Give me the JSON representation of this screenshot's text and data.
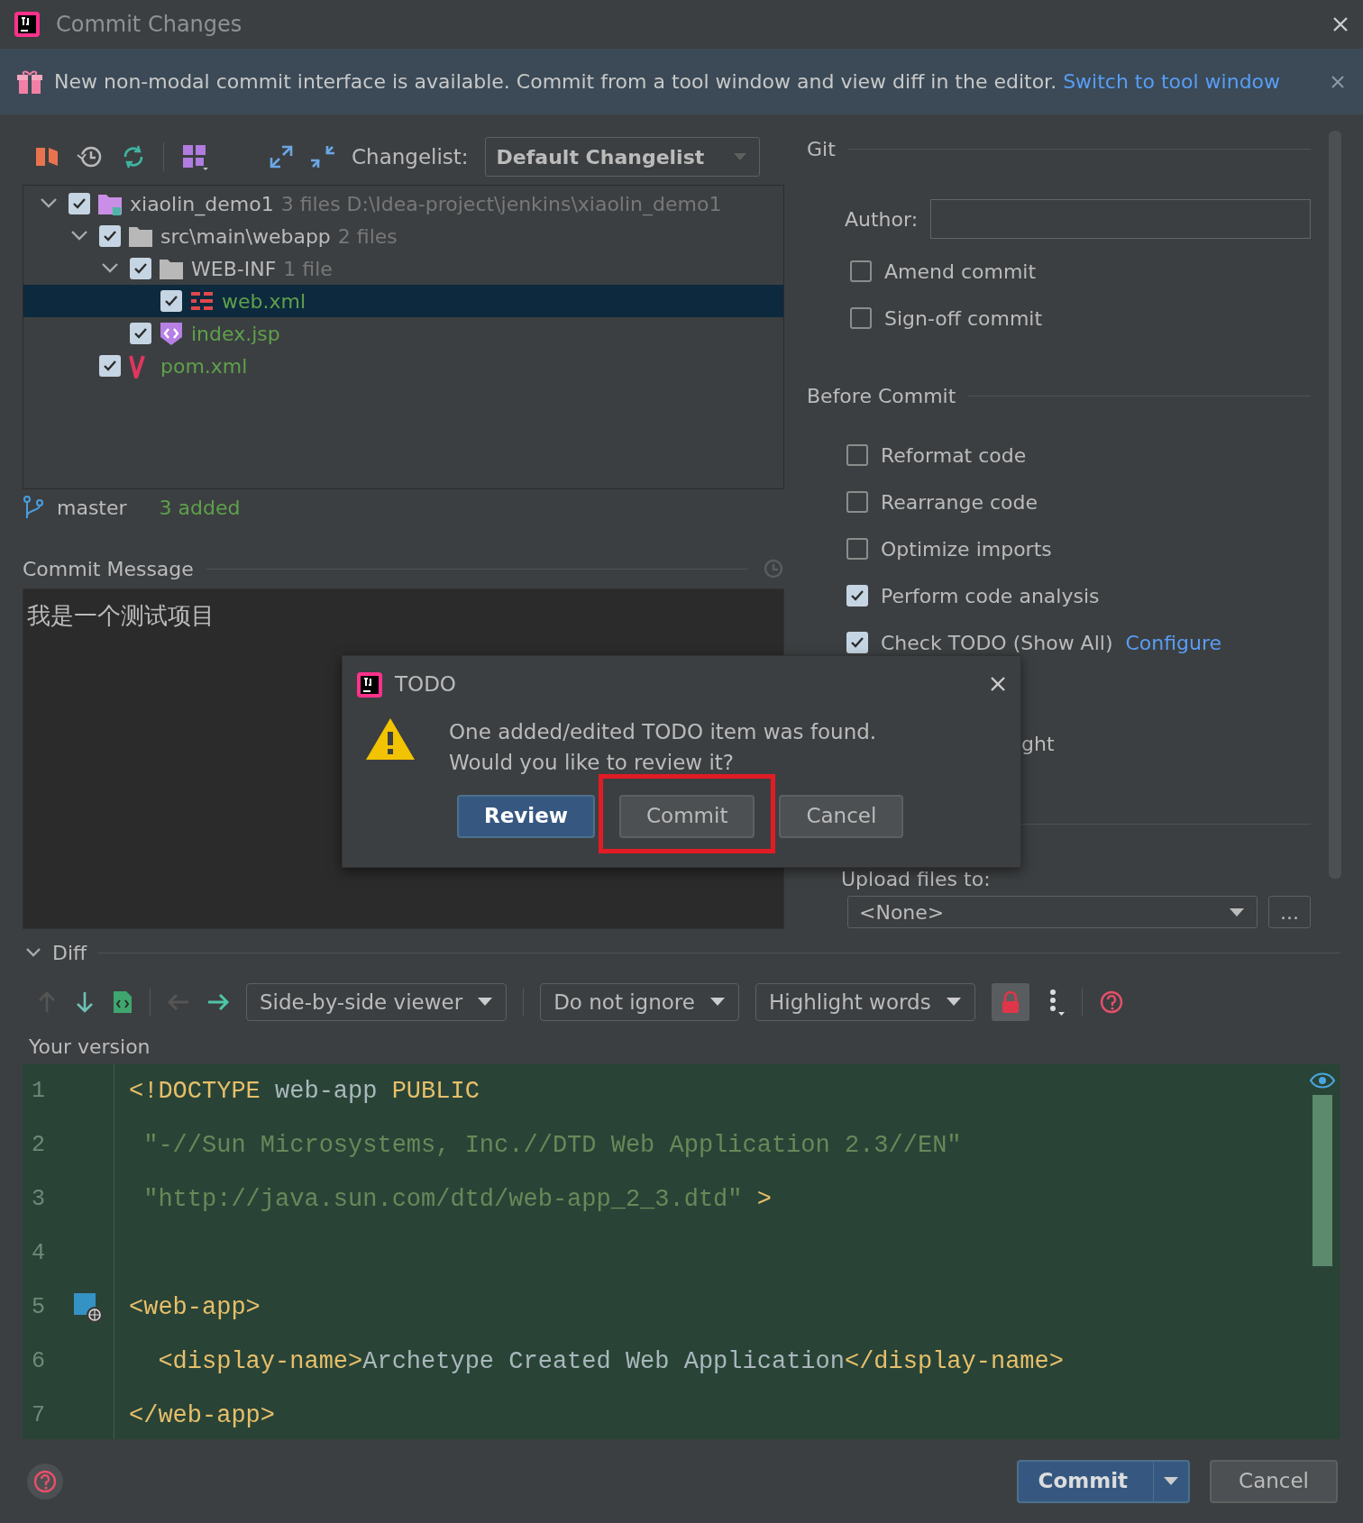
{
  "window": {
    "title": "Commit Changes"
  },
  "banner": {
    "text": "New non-modal commit interface is available. Commit from a tool window and view diff in the editor.",
    "link": "Switch to tool window"
  },
  "changes": {
    "changelist_label": "Changelist:",
    "changelist": "Default Changelist",
    "tree": [
      {
        "name": "xiaolin_demo1",
        "detail": "3 files  D:\\Idea-project\\jenkins\\xiaolin_demo1",
        "kind": "module",
        "checked": true,
        "expanded": true,
        "selected": false,
        "added": false,
        "children": [
          {
            "name": "src\\main\\webapp",
            "detail": "2 files",
            "kind": "folder",
            "checked": true,
            "expanded": true,
            "selected": false,
            "added": false,
            "children": [
              {
                "name": "WEB-INF",
                "detail": "1 file",
                "kind": "folder",
                "checked": true,
                "expanded": true,
                "selected": false,
                "added": false,
                "children": [
                  {
                    "name": "web.xml",
                    "kind": "xml",
                    "checked": true,
                    "selected": true,
                    "added": true
                  }
                ]
              },
              {
                "name": "index.jsp",
                "kind": "jsp",
                "checked": true,
                "selected": false,
                "added": true
              }
            ]
          },
          {
            "name": "pom.xml",
            "kind": "maven",
            "checked": true,
            "selected": false,
            "added": true
          }
        ]
      }
    ],
    "branch": "master",
    "summary": "3 added"
  },
  "commit_message": {
    "label": "Commit Message",
    "value": "我是一个测试项目"
  },
  "git": {
    "title": "Git",
    "author_label": "Author:",
    "options": [
      {
        "label": "Amend commit",
        "checked": false
      },
      {
        "label": "Sign-off commit",
        "checked": false
      }
    ]
  },
  "before_commit": {
    "title": "Before Commit",
    "options": [
      {
        "label": "Reformat code",
        "checked": false
      },
      {
        "label": "Rearrange code",
        "checked": false
      },
      {
        "label": "Optimize imports",
        "checked": false
      },
      {
        "label": "Perform code analysis",
        "checked": true
      },
      {
        "label": "Check TODO (Show All)",
        "checked": true,
        "link": "Configure"
      }
    ],
    "partial_text": "ght"
  },
  "upload": {
    "label": "Upload files to:",
    "value": "<None>",
    "browse": "..."
  },
  "diff": {
    "title": "Diff",
    "expanded": true,
    "viewer": "Side-by-side viewer",
    "ignore": "Do not ignore",
    "highlight": "Highlight words",
    "side_label": "Your version",
    "lines": [
      {
        "number": "1",
        "segments": [
          {
            "kind": "tag",
            "text": "<!DOCTYPE"
          },
          {
            "kind": "text",
            "text": " web-app "
          },
          {
            "kind": "tag",
            "text": "PUBLIC"
          }
        ]
      },
      {
        "number": "2",
        "segments": [
          {
            "kind": "string",
            "text": " \"-//Sun Microsystems, Inc.//DTD Web Application 2.3//EN\""
          }
        ]
      },
      {
        "number": "3",
        "segments": [
          {
            "kind": "string",
            "text": " \"http://java.sun.com/dtd/web-app_2_3.dtd\""
          },
          {
            "kind": "tag",
            "text": " >"
          }
        ]
      },
      {
        "number": "4"
      },
      {
        "number": "5",
        "gutter_icon": true,
        "segments": [
          {
            "kind": "tag",
            "text": "<web-app>"
          }
        ]
      },
      {
        "number": "6",
        "segments": [
          {
            "kind": "tag",
            "text": "  <display-name>"
          },
          {
            "kind": "text",
            "text": "Archetype Created Web Application"
          },
          {
            "kind": "tag",
            "text": "</display-name>"
          }
        ]
      },
      {
        "number": "7",
        "segments": [
          {
            "kind": "tag",
            "text": "</web-app>"
          }
        ]
      }
    ]
  },
  "dialog": {
    "title": "TODO",
    "message_lines": [
      "One added/edited TODO item was found.",
      "Would you like to review it?"
    ],
    "buttons": [
      {
        "label": "Review",
        "default": true,
        "highlighted": false
      },
      {
        "label": "Commit",
        "default": false,
        "highlighted": true
      },
      {
        "label": "Cancel",
        "default": false,
        "highlighted": false
      }
    ]
  },
  "footer": {
    "buttons": [
      {
        "label": "Commit",
        "kind": "split"
      },
      {
        "label": "Cancel",
        "kind": "plain"
      }
    ]
  }
}
